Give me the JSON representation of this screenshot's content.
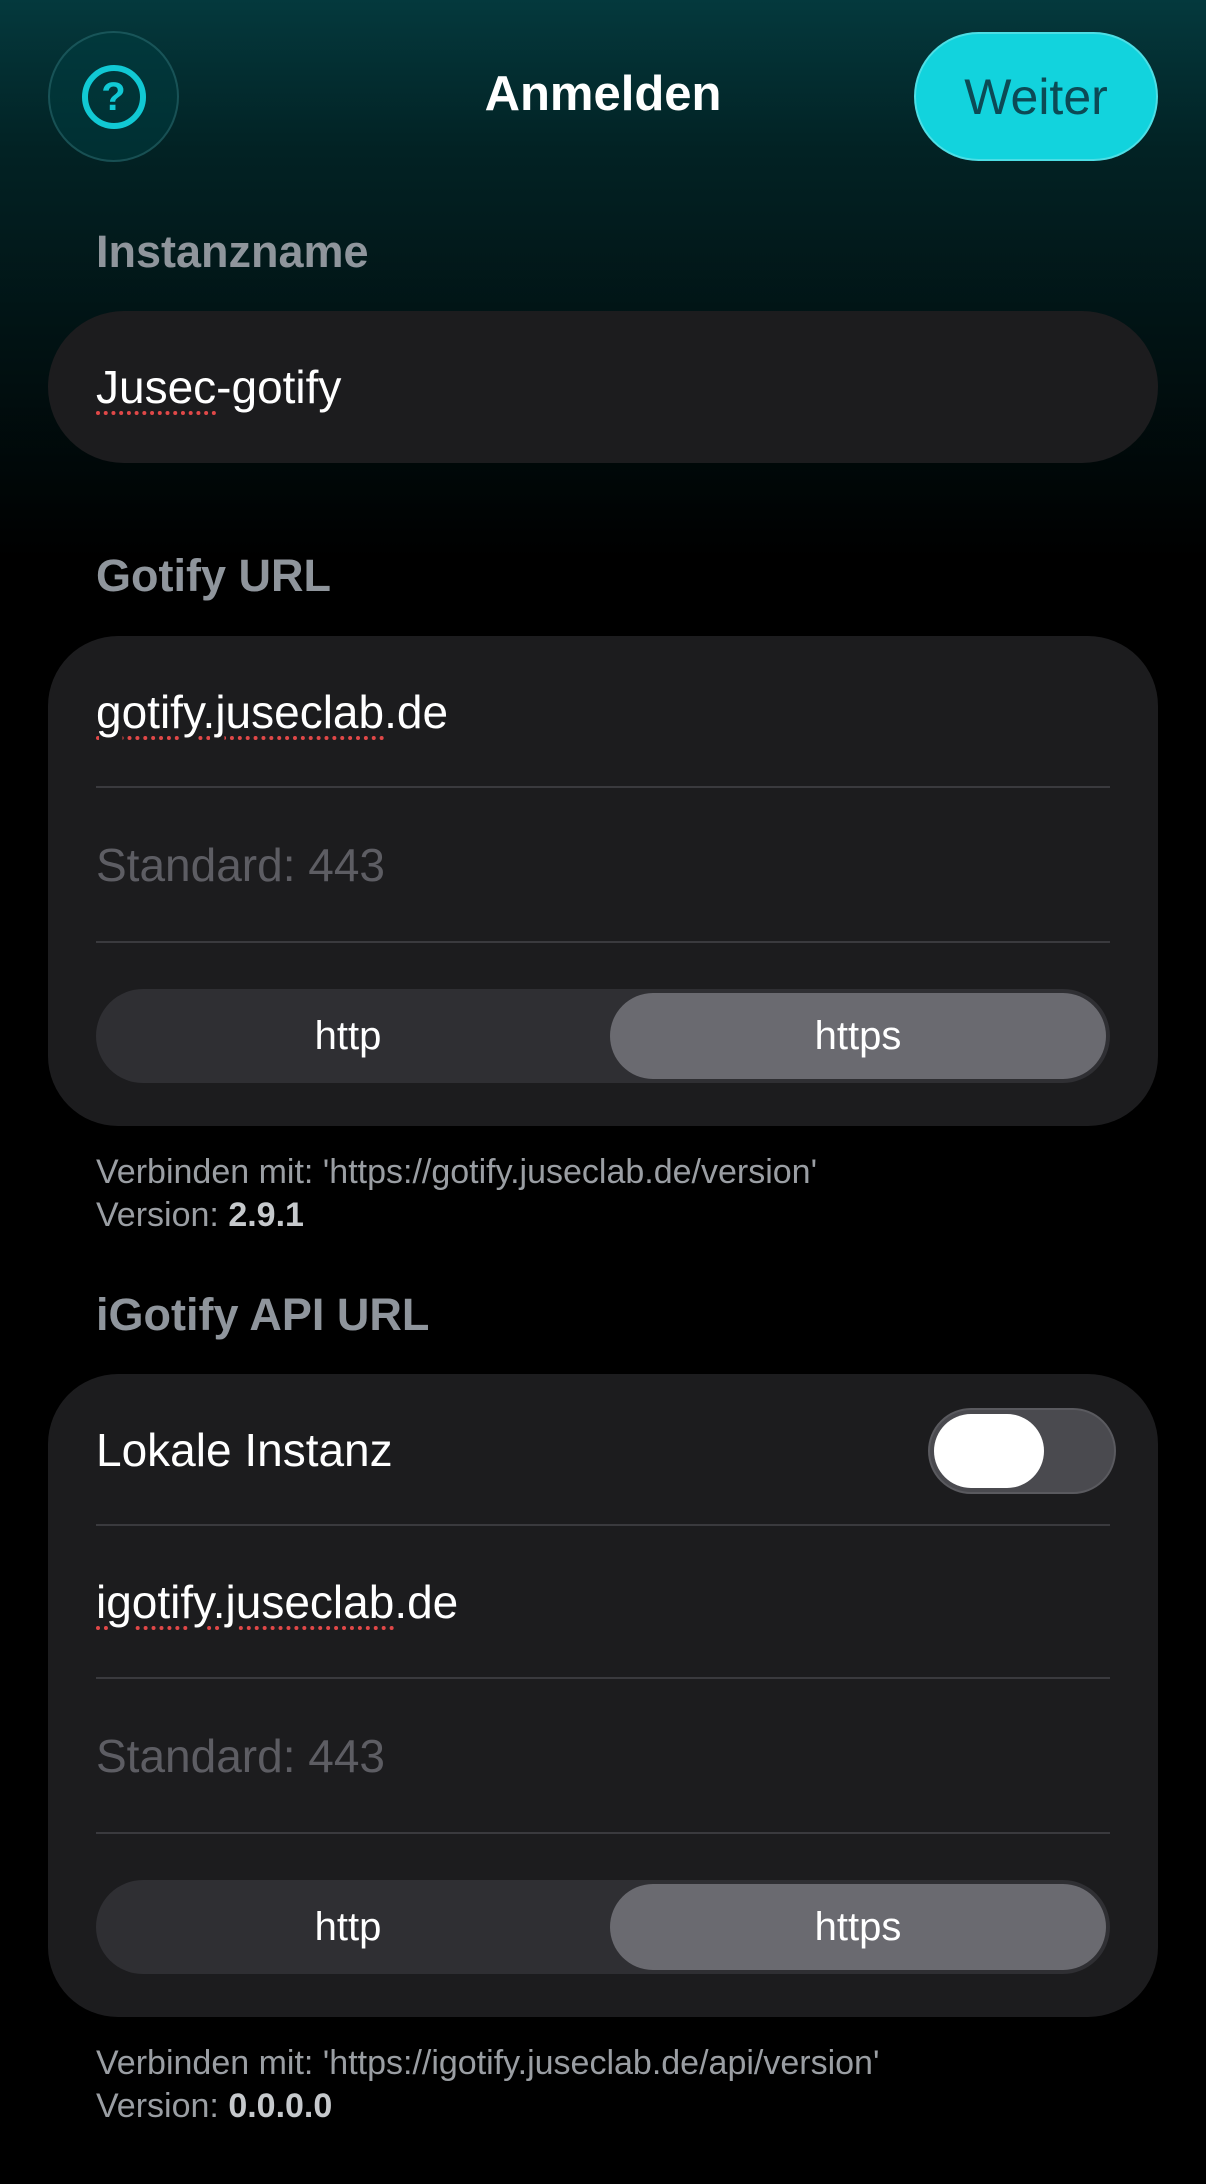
{
  "header": {
    "help_icon_glyph": "?",
    "title": "Anmelden",
    "next_label": "Weiter"
  },
  "instance": {
    "label": "Instanzname",
    "name_prefix": "Jusec",
    "name_suffix": "-gotify"
  },
  "gotify": {
    "label": "Gotify URL",
    "host_underlined": "gotify.juseclab",
    "host_suffix": ".de",
    "port_placeholder": "Standard: 443",
    "protocol_options": [
      "http",
      "https"
    ],
    "protocol_selected": "https",
    "connect_text": "Verbinden mit: 'https://gotify.juseclab.de/version'",
    "version_label": "Version: ",
    "version_value": "2.9.1"
  },
  "igotify": {
    "label": "iGotify API URL",
    "local_instance_label": "Lokale Instanz",
    "local_instance_on": false,
    "host_underlined": "igotify.juseclab",
    "host_suffix": ".de",
    "port_placeholder": "Standard: 443",
    "protocol_options": [
      "http",
      "https"
    ],
    "protocol_selected": "https",
    "connect_text": "Verbinden mit: 'https://igotify.juseclab.de/api/version'",
    "version_label": "Version: ",
    "version_value": "0.0.0.0"
  },
  "colors": {
    "accent": "#12d3dd",
    "card": "#1c1c1e",
    "segment_active": "#6a6a70"
  }
}
